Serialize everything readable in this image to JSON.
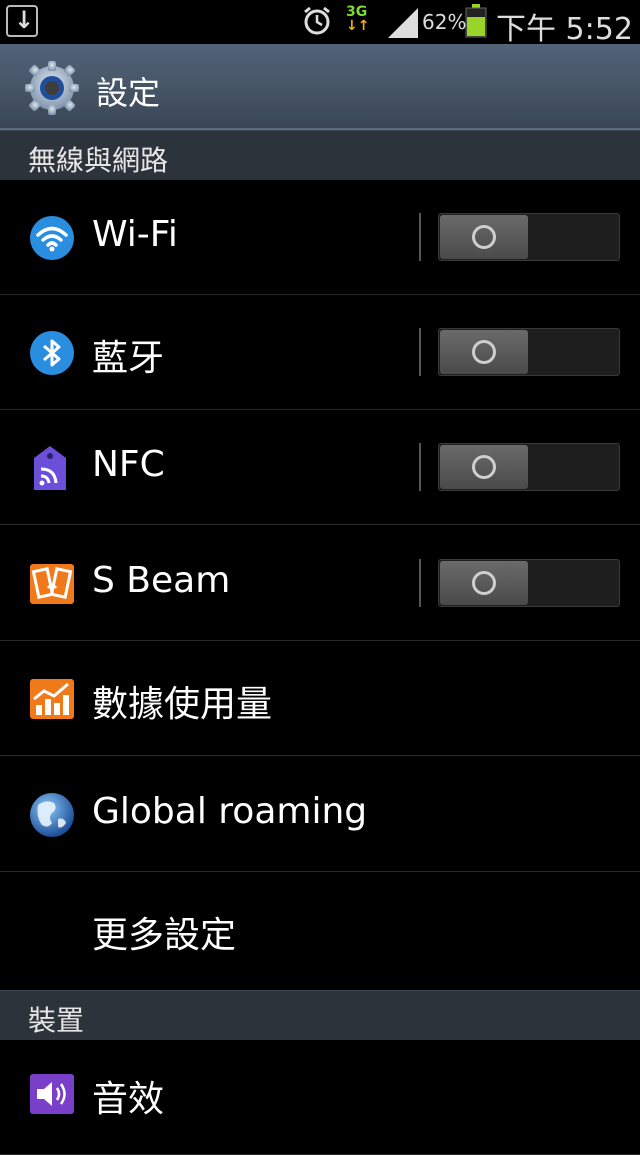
{
  "status_bar": {
    "battery_pct": "62%",
    "time": "下午 5:52",
    "network": "3G",
    "network_arrows": "↓↑"
  },
  "header": {
    "title": "設定"
  },
  "sections": {
    "wireless": {
      "title": "無線與網路"
    },
    "device": {
      "title": "裝置"
    }
  },
  "items": {
    "wifi": {
      "label": "Wi-Fi",
      "toggle": "off"
    },
    "bluetooth": {
      "label": "藍牙",
      "toggle": "off"
    },
    "nfc": {
      "label": "NFC",
      "toggle": "off"
    },
    "sbeam": {
      "label": "S Beam",
      "toggle": "off"
    },
    "data_usage": {
      "label": "數據使用量"
    },
    "global_roaming": {
      "label": "Global roaming"
    },
    "more_settings": {
      "label": "更多設定"
    },
    "sound": {
      "label": "音效"
    }
  },
  "colors": {
    "action_bar": "#475568",
    "section_header": "#2d333b",
    "wifi_icon": "#2a8ee0",
    "bluetooth_icon": "#2a8ee0",
    "nfc_icon": "#6b4fd8",
    "sbeam_icon": "#f07a1a",
    "data_usage_icon": "#f07a1a",
    "sound_icon": "#7a3fc8"
  }
}
